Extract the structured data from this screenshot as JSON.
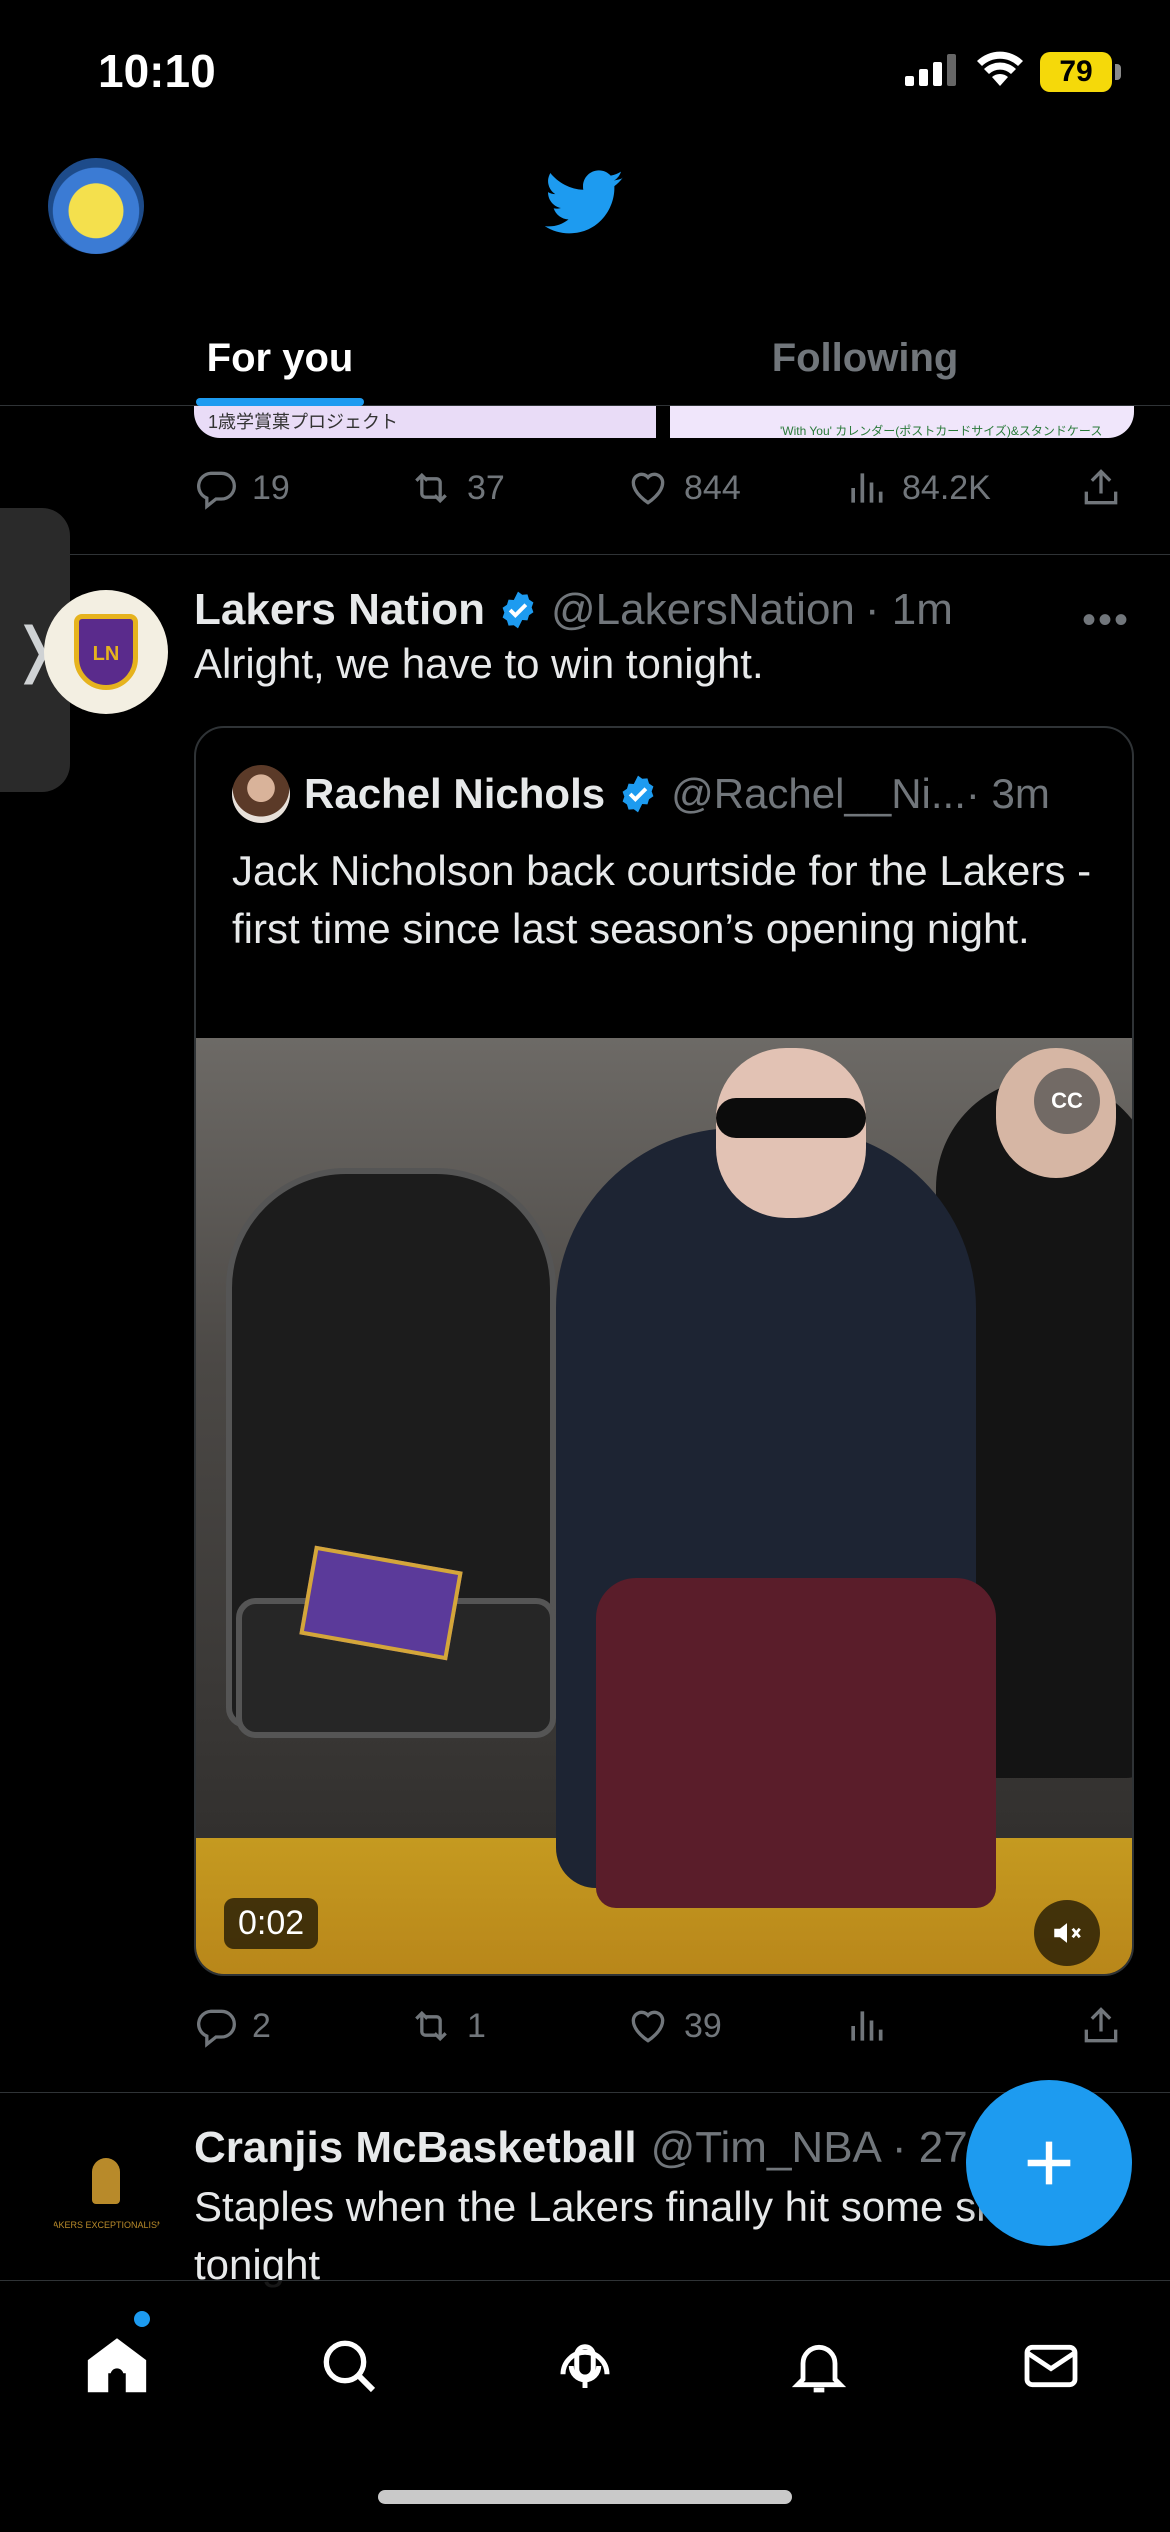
{
  "status_bar": {
    "time": "10:10",
    "battery": "79"
  },
  "header": {
    "tabs": [
      {
        "label": "For you"
      },
      {
        "label": "Following"
      }
    ]
  },
  "previous_tweet": {
    "media_left_caption": "1歳学賞菓プロジェクト",
    "media_right_caption": "'With You' カレンダー(ポストカードサイズ)&スタンドケース",
    "stats": {
      "replies": "19",
      "retweets": "37",
      "likes": "844",
      "views": "84.2K"
    }
  },
  "tweet": {
    "author": {
      "name": "Lakers Nation",
      "handle": "@LakersNation",
      "time": "· 1m"
    },
    "avatar_text": "LN",
    "text": "Alright, we have to win tonight.",
    "quote": {
      "author": {
        "name": "Rachel Nichols",
        "handle": "@Rachel__Ni...",
        "time": "· 3m"
      },
      "text": "Jack Nicholson back courtside for the Lakers - first time since last season’s opening night.",
      "video": {
        "duration": "0:02",
        "cc_label": "CC"
      }
    },
    "stats": {
      "replies": "2",
      "retweets": "1",
      "likes": "39"
    }
  },
  "next_tweet": {
    "author": {
      "name": "Cranjis McBasketball",
      "handle": "@Tim_NBA",
      "time": "· 27m"
    },
    "avatar_text": "LAKERS EXCEPTIONALISM",
    "text": "Staples when the Lakers finally hit some shots tonight"
  },
  "icons": {
    "bird": "twitter-bird-icon",
    "compose": "plus-icon",
    "nav": [
      "home-icon",
      "search-icon",
      "spaces-icon",
      "bell-icon",
      "mail-icon"
    ]
  },
  "colors": {
    "accent": "#1d9bf0",
    "background": "#000000",
    "muted": "#71767b",
    "battery": "#f5d90a"
  }
}
